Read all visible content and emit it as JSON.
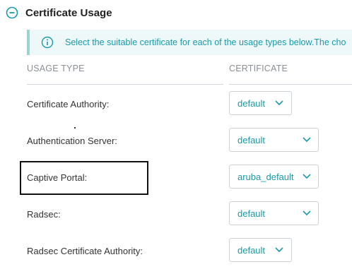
{
  "section": {
    "title": "Certificate Usage",
    "collapse_icon": "minus-circle-icon"
  },
  "info": {
    "icon": "info-circle-icon",
    "text": "Select the suitable certificate for each of the usage types below.The cho"
  },
  "table": {
    "headers": {
      "usage_type": "USAGE TYPE",
      "certificate": "CERTIFICATE"
    },
    "rows": [
      {
        "label": "Certificate Authority:",
        "value": "default"
      },
      {
        "label": "Authentication Server:",
        "value": "default"
      },
      {
        "label": "Captive Portal:",
        "value": "aruba_default"
      },
      {
        "label": "Radsec:",
        "value": "default"
      },
      {
        "label": "Radsec Certificate Authority:",
        "value": "default"
      }
    ]
  },
  "colors": {
    "accent": "#1b9aa6",
    "banner_bg": "#eef8f9",
    "banner_border": "#9fd3cf"
  }
}
